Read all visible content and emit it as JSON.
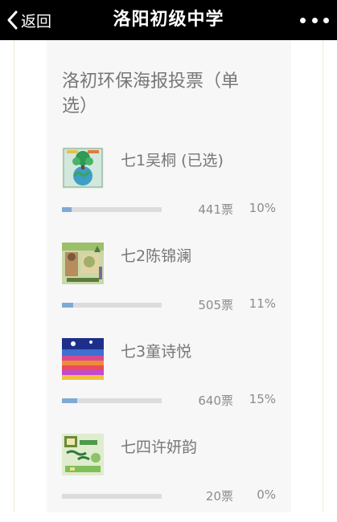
{
  "header": {
    "back_label": "返回",
    "title": "洛阳初级中学",
    "back_icon": "chevron-left-icon",
    "more_icon": "more-dots-icon"
  },
  "poll": {
    "title": "洛初环保海报投票（单选）",
    "options": [
      {
        "name": "七1吴桐 (已选)",
        "votes": "441票",
        "percent": "10%",
        "fraction": 0.1,
        "thumbnail": "poster-earth-tree"
      },
      {
        "name": "七2陈锦澜",
        "votes": "505票",
        "percent": "11%",
        "fraction": 0.11,
        "thumbnail": "poster-animals-forest"
      },
      {
        "name": "七3童诗悦",
        "votes": "640票",
        "percent": "15%",
        "fraction": 0.15,
        "thumbnail": "poster-color-stripes"
      },
      {
        "name": "七四许妍韵",
        "votes": "20票",
        "percent": "0%",
        "fraction": 0.0,
        "thumbnail": "poster-green-text"
      }
    ]
  },
  "colors": {
    "header_bg": "#000000",
    "card_bg": "#f7f7f7",
    "bar_fill": "#7fa9d6",
    "bar_track": "#dcdcdc",
    "text_gray": "#777777"
  }
}
